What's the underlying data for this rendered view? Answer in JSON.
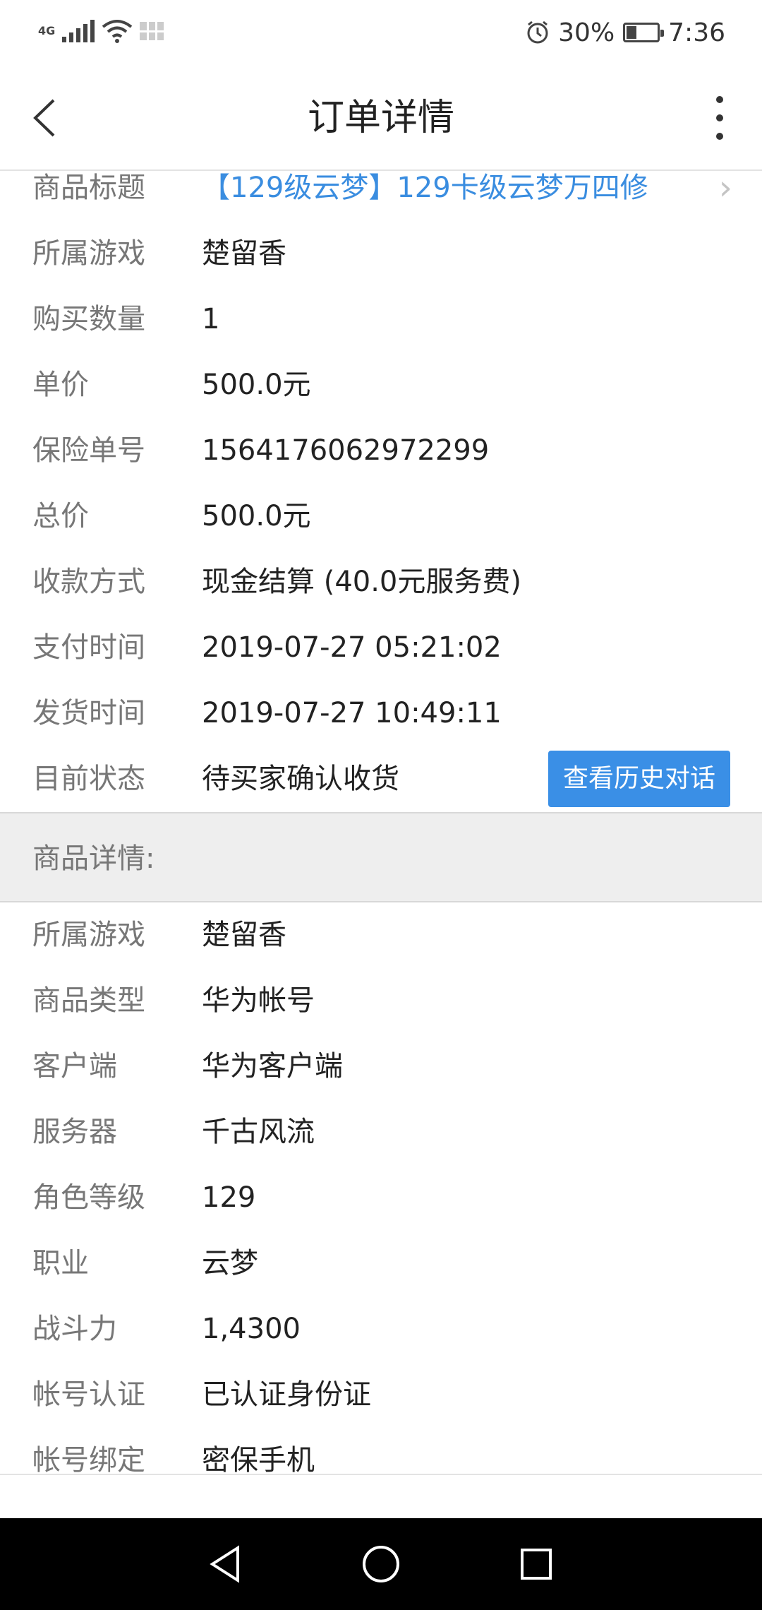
{
  "status_bar": {
    "network": "4G",
    "battery_percent": "30%",
    "battery_level": 0.3,
    "time": "7:36",
    "icons": [
      "signal-icon",
      "wifi-icon",
      "notification-grid-icon",
      "alarm-icon",
      "battery-icon"
    ]
  },
  "header": {
    "title": "订单详情",
    "back_icon": "chevron-left-icon",
    "more_icon": "more-vertical-icon"
  },
  "order": {
    "title_label": "商品标题",
    "title_value": "【129级云梦】129卡级云梦万四修",
    "fields": [
      {
        "label": "所属游戏",
        "value": "楚留香"
      },
      {
        "label": "购买数量",
        "value": "1"
      },
      {
        "label": "单价",
        "value": "500.0元"
      },
      {
        "label": "保险单号",
        "value": "1564176062972299"
      },
      {
        "label": "总价",
        "value": "500.0元"
      },
      {
        "label": "收款方式",
        "value": "现金结算 (40.0元服务费)"
      },
      {
        "label": "支付时间",
        "value": "2019-07-27 05:21:02"
      },
      {
        "label": "发货时间",
        "value": "2019-07-27 10:49:11"
      }
    ],
    "status_label": "目前状态",
    "status_value": "待买家确认收货",
    "history_button": "查看历史对话"
  },
  "details": {
    "section_title": "商品详情:",
    "fields": [
      {
        "label": "所属游戏",
        "value": "楚留香"
      },
      {
        "label": "商品类型",
        "value": "华为帐号"
      },
      {
        "label": "客户端",
        "value": "华为客户端"
      },
      {
        "label": "服务器",
        "value": "千古风流"
      },
      {
        "label": "角色等级",
        "value": "129"
      },
      {
        "label": "职业",
        "value": "云梦"
      },
      {
        "label": "战斗力",
        "value": "1,4300"
      },
      {
        "label": "帐号认证",
        "value": "已认证身份证"
      },
      {
        "label": "帐号绑定",
        "value": "密保手机"
      }
    ]
  },
  "nav_bar": {
    "icons": [
      "back-triangle-icon",
      "home-circle-icon",
      "recents-square-icon"
    ]
  },
  "colors": {
    "accent": "#3a8fe6",
    "link": "#3a8de0",
    "label": "#777777",
    "value": "#222222",
    "section_bg": "#eeeeee"
  }
}
